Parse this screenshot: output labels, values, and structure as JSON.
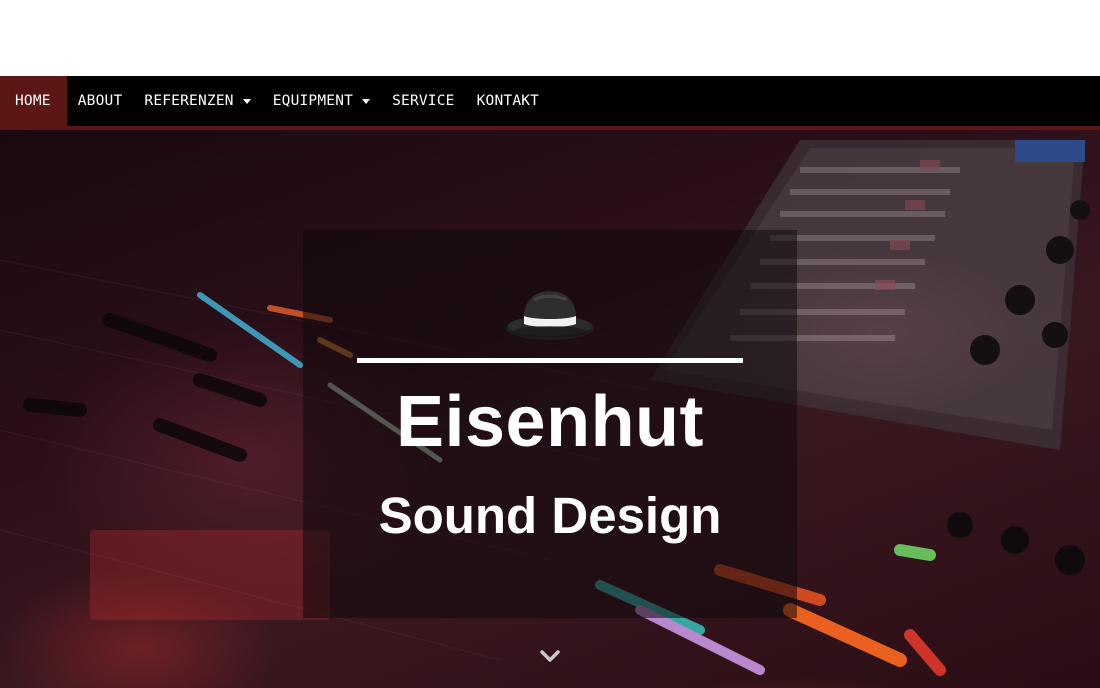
{
  "nav": {
    "items": [
      {
        "label": "HOME",
        "active": true,
        "dropdown": false
      },
      {
        "label": "ABOUT",
        "active": false,
        "dropdown": false
      },
      {
        "label": "REFERENZEN",
        "active": false,
        "dropdown": true
      },
      {
        "label": "EQUIPMENT",
        "active": false,
        "dropdown": true
      },
      {
        "label": "SERVICE",
        "active": false,
        "dropdown": false
      },
      {
        "label": "KONTAKT",
        "active": false,
        "dropdown": false
      }
    ]
  },
  "hero": {
    "title": "Eisenhut",
    "subtitle": "Sound Design",
    "logo_icon": "fedora-hat-icon",
    "scroll_icon": "chevron-down-icon",
    "background_description_icon": "mixing-console-photo"
  },
  "colors": {
    "nav_background": "#000000",
    "nav_active": "#5c1616",
    "nav_text": "#ffffff",
    "hero_text": "#ffffff"
  }
}
